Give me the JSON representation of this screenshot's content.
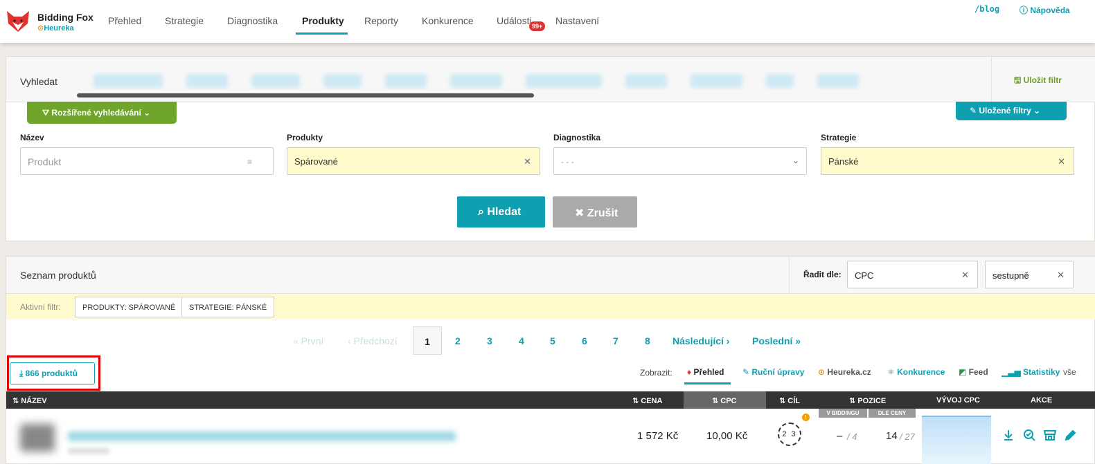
{
  "app": {
    "name": "Bidding Fox",
    "sub": "Heureka"
  },
  "nav": {
    "items": [
      "Přehled",
      "Strategie",
      "Diagnostika",
      "Produkty",
      "Reporty",
      "Konkurence",
      "Události",
      "Nastavení"
    ],
    "active": "Produkty",
    "events_badge": "99+"
  },
  "toplinks": {
    "blog": "/blog",
    "help": "Nápověda"
  },
  "search": {
    "label": "Vyhledat",
    "save_filter": "Uložit filtr",
    "advanced": "Rozšířené vyhledávání",
    "saved_filters": "Uložené filtry",
    "fields": {
      "name_label": "Název",
      "name_placeholder": "Produkt",
      "products_label": "Produkty",
      "products_value": "Spárované",
      "diag_label": "Diagnostika",
      "diag_value": "- - -",
      "strategy_label": "Strategie",
      "strategy_value": "Pánské"
    },
    "search_btn": "Hledat",
    "cancel_btn": "Zrušit"
  },
  "list": {
    "title": "Seznam produktů",
    "sort_label": "Řadit dle:",
    "sort_field": "CPC",
    "sort_dir": "sestupně",
    "active_filter_label": "Aktivní filtr:",
    "active_filters": [
      "PRODUKTY: SPÁROVANÉ",
      "STRATEGIE: PÁNSKÉ"
    ],
    "pager": {
      "first": "« První",
      "prev": "‹ Předchozí",
      "current": "1",
      "pages": [
        "2",
        "3",
        "4",
        "5",
        "6",
        "7",
        "8"
      ],
      "next": "Následující ›",
      "last": "Poslední »"
    },
    "count": "866 produktů",
    "view_label": "Zobrazit:",
    "views": [
      "Přehled",
      "Ruční úpravy",
      "Heureka.cz",
      "Konkurence",
      "Feed",
      "Statistiky",
      "vše"
    ],
    "columns": {
      "name": "NÁZEV",
      "price": "CENA",
      "cpc": "CPC",
      "target": "CÍL",
      "position": "POZICE",
      "cpc_trend": "VÝVOJ CPC",
      "actions": "AKCE",
      "sub_bidding": "V BIDDINGU",
      "sub_price": "DLE CENY"
    },
    "row": {
      "price": "1 572 Kč",
      "cpc": "10,00 Kč",
      "target": "2 3",
      "pos_bidding": "–",
      "pos_bidding_total": "/ 4",
      "pos_price": "14",
      "pos_price_total": "/ 27"
    }
  },
  "colors": {
    "accent": "#0e9fb0",
    "green": "#6ea52a",
    "highlight": "#e00000"
  }
}
